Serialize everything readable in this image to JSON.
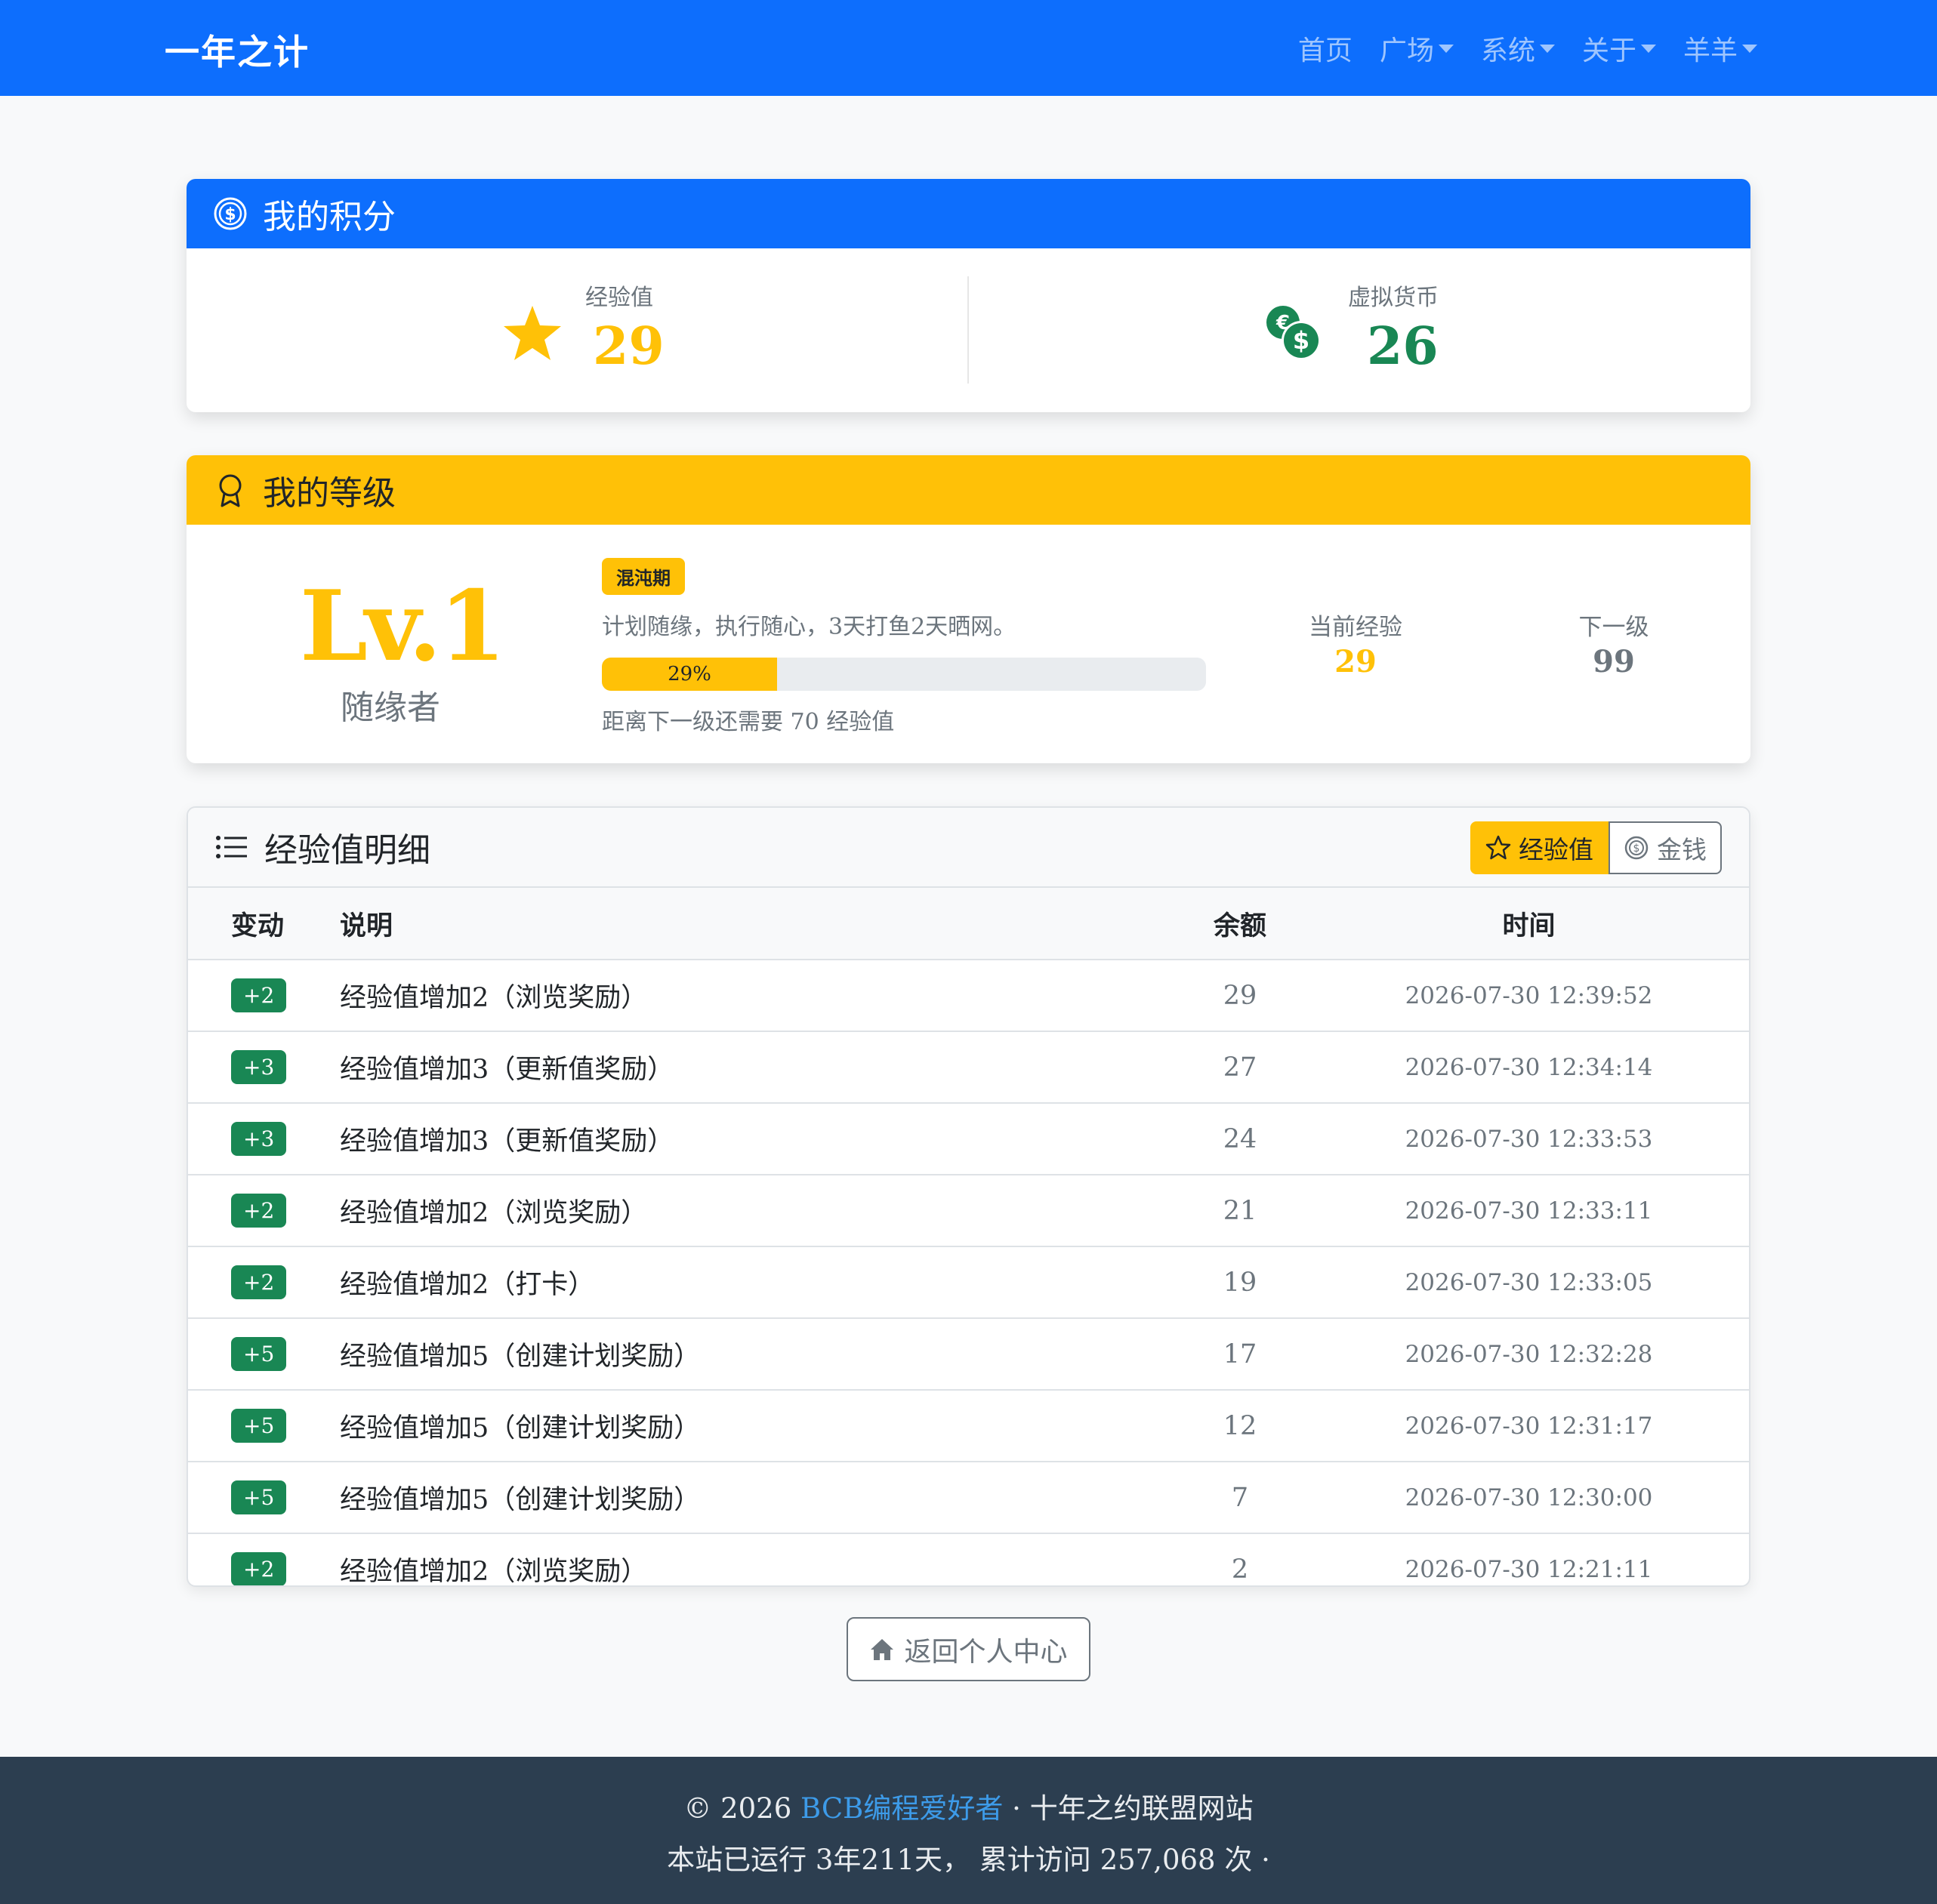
{
  "navbar": {
    "brand": "一年之计",
    "items": [
      {
        "label": "首页",
        "dropdown": false
      },
      {
        "label": "广场",
        "dropdown": true
      },
      {
        "label": "系统",
        "dropdown": true
      },
      {
        "label": "关于",
        "dropdown": true
      },
      {
        "label": "羊羊",
        "dropdown": true
      }
    ]
  },
  "points": {
    "title": "我的积分",
    "exp_label": "经验值",
    "exp_value": "29",
    "coin_label": "虚拟货币",
    "coin_value": "26"
  },
  "level": {
    "title": "我的等级",
    "level_text": "Lv.1",
    "level_name": "随缘者",
    "stage_badge": "混沌期",
    "description": "计划随缘，执行随心，3天打鱼2天晒网。",
    "progress_percent": 29,
    "progress_label": "29%",
    "remaining": "距离下一级还需要 70 经验值",
    "current_label": "当前经验",
    "current_value": "29",
    "next_label": "下一级",
    "next_value": "99"
  },
  "detail": {
    "title": "经验值明细",
    "toggle_exp": "经验值",
    "toggle_money": "金钱",
    "columns": [
      "变动",
      "说明",
      "余额",
      "时间"
    ],
    "rows": [
      {
        "change": "+2",
        "desc": "经验值增加2（浏览奖励）",
        "balance": "29",
        "time": "2026-07-30 12:39:52"
      },
      {
        "change": "+3",
        "desc": "经验值增加3（更新值奖励）",
        "balance": "27",
        "time": "2026-07-30 12:34:14"
      },
      {
        "change": "+3",
        "desc": "经验值增加3（更新值奖励）",
        "balance": "24",
        "time": "2026-07-30 12:33:53"
      },
      {
        "change": "+2",
        "desc": "经验值增加2（浏览奖励）",
        "balance": "21",
        "time": "2026-07-30 12:33:11"
      },
      {
        "change": "+2",
        "desc": "经验值增加2（打卡）",
        "balance": "19",
        "time": "2026-07-30 12:33:05"
      },
      {
        "change": "+5",
        "desc": "经验值增加5（创建计划奖励）",
        "balance": "17",
        "time": "2026-07-30 12:32:28"
      },
      {
        "change": "+5",
        "desc": "经验值增加5（创建计划奖励）",
        "balance": "12",
        "time": "2026-07-30 12:31:17"
      },
      {
        "change": "+5",
        "desc": "经验值增加5（创建计划奖励）",
        "balance": "7",
        "time": "2026-07-30 12:30:00"
      },
      {
        "change": "+2",
        "desc": "经验值增加2（浏览奖励）",
        "balance": "2",
        "time": "2026-07-30 12:21:11"
      }
    ]
  },
  "back_button": "返回个人中心",
  "footer": {
    "copyright": "© 2026 ",
    "site_link": "BCB编程爱好者",
    "suffix": " · 十年之约联盟网站",
    "running": "本站已运行 3年211天， 累计访问 257,068 次 ·"
  },
  "colors": {
    "primary": "#0d6efd",
    "warning": "#ffc107",
    "success": "#198754",
    "footer_bg": "#2c3e50"
  },
  "icons": {
    "points_header": "coin-circle-icon",
    "exp": "star-fill-icon",
    "coin": "coins-icon",
    "level_header": "award-icon",
    "detail_header": "list-icon",
    "toggle_exp": "star-outline-icon",
    "toggle_money": "coin-icon",
    "back": "house-icon"
  }
}
